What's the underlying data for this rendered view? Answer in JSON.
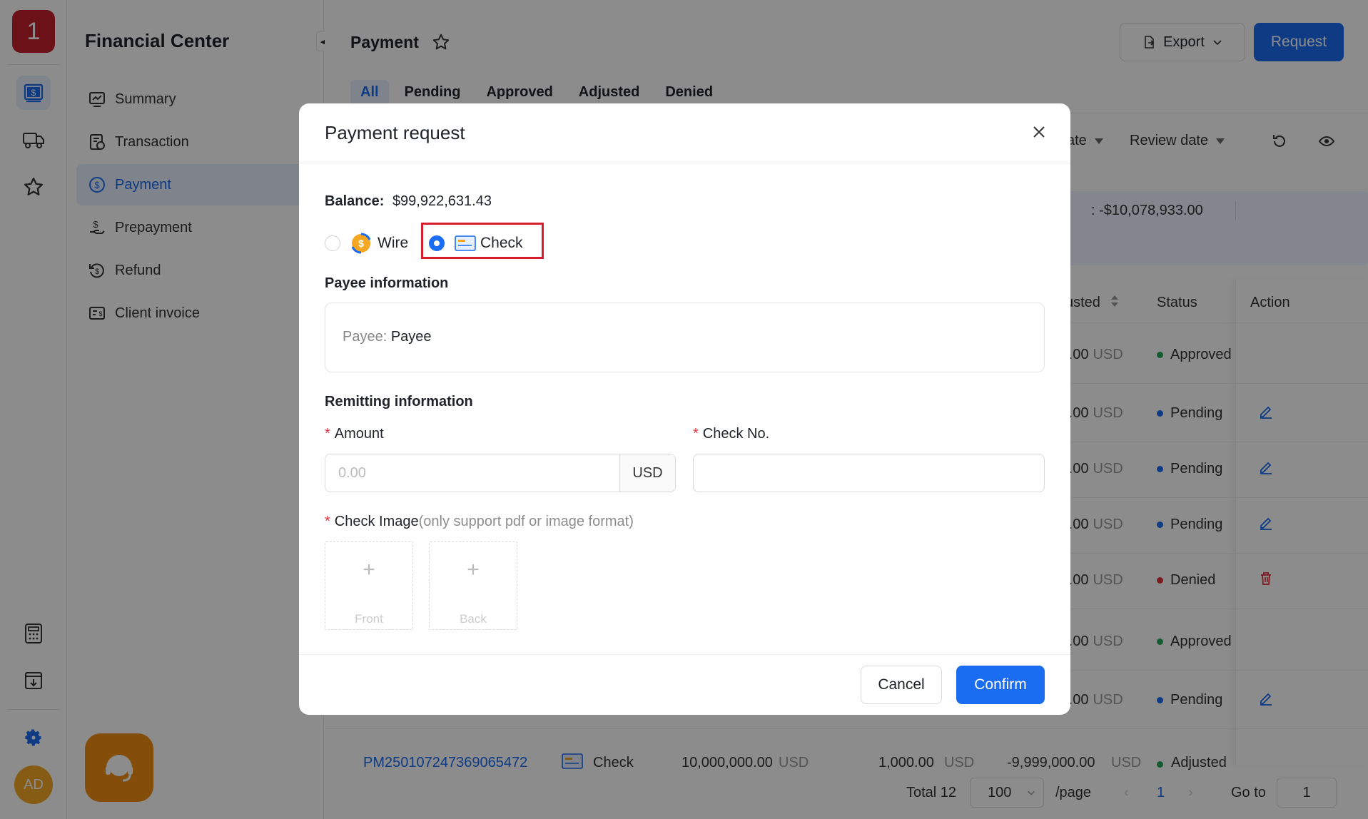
{
  "app": {
    "logo_text": "1",
    "avatar_initials": "AD",
    "accent_color": "#1a6cf0",
    "brand_color": "#c4202b"
  },
  "sidebar": {
    "title": "Financial Center",
    "items": [
      {
        "label": "Summary",
        "icon": "chart-monitor-icon",
        "active": false
      },
      {
        "label": "Transaction",
        "icon": "transaction-icon",
        "active": false
      },
      {
        "label": "Payment",
        "icon": "dollar-circle-icon",
        "active": true
      },
      {
        "label": "Prepayment",
        "icon": "hand-dollar-icon",
        "active": false
      },
      {
        "label": "Refund",
        "icon": "refund-icon",
        "active": false
      },
      {
        "label": "Client invoice",
        "icon": "invoice-icon",
        "active": false
      }
    ]
  },
  "header": {
    "title": "Payment",
    "export_label": "Export",
    "request_label": "Request"
  },
  "tabs": [
    "All",
    "Pending",
    "Approved",
    "Adjusted",
    "Denied"
  ],
  "filters": {
    "date_partial": "ate",
    "review_date": "Review date"
  },
  "summary": {
    "partial_total": ": -$10,078,933.00"
  },
  "table": {
    "headers": {
      "adjusted_partial": "usted",
      "status": "Status",
      "action": "Action"
    },
    "rows": [
      {
        "amount": ").00",
        "currency": "USD",
        "status": "Approved",
        "status_color": "#27a55b",
        "action": ""
      },
      {
        "amount": ").00",
        "currency": "USD",
        "status": "Pending",
        "status_color": "#1a6cf0",
        "action": "edit"
      },
      {
        "amount": ").00",
        "currency": "USD",
        "status": "Pending",
        "status_color": "#1a6cf0",
        "action": "edit"
      },
      {
        "amount": ").00",
        "currency": "USD",
        "status": "Pending",
        "status_color": "#1a6cf0",
        "action": "edit"
      },
      {
        "amount": ").00",
        "currency": "USD",
        "status": "Denied",
        "status_color": "#e0303c",
        "action": "delete"
      },
      {
        "amount": ").00",
        "currency": "USD",
        "status": "Approved",
        "status_color": "#27a55b",
        "action": ""
      },
      {
        "amount": ").00",
        "currency": "USD",
        "status": "Pending",
        "status_color": "#1a6cf0",
        "action": "edit"
      }
    ],
    "last_row": {
      "id": "PM250107247369065472",
      "method": "Check",
      "amount": "10,000,000.00",
      "currency": "USD",
      "fee": "1,000.00",
      "adjusted": "-9,999,000.00",
      "status": "Adjusted"
    }
  },
  "pagination": {
    "total_label": "Total 12",
    "page_size": "100",
    "per_page_label": "/page",
    "current_page": "1",
    "goto_label": "Go to",
    "goto_value": "1"
  },
  "modal": {
    "title": "Payment request",
    "balance_label": "Balance:",
    "balance_value": "$99,922,631.43",
    "methods": [
      {
        "label": "Wire",
        "selected": false
      },
      {
        "label": "Check",
        "selected": true
      }
    ],
    "payee_section": "Payee information",
    "payee_label": "Payee:",
    "payee_value": "Payee",
    "remit_section": "Remitting information",
    "amount_label": "Amount",
    "amount_placeholder": "0.00",
    "amount_currency": "USD",
    "check_no_label": "Check No.",
    "check_image_label": "Check Image",
    "check_image_hint": "(only support pdf or image format)",
    "upload_front": "Front",
    "upload_back": "Back",
    "cancel_label": "Cancel",
    "confirm_label": "Confirm"
  }
}
